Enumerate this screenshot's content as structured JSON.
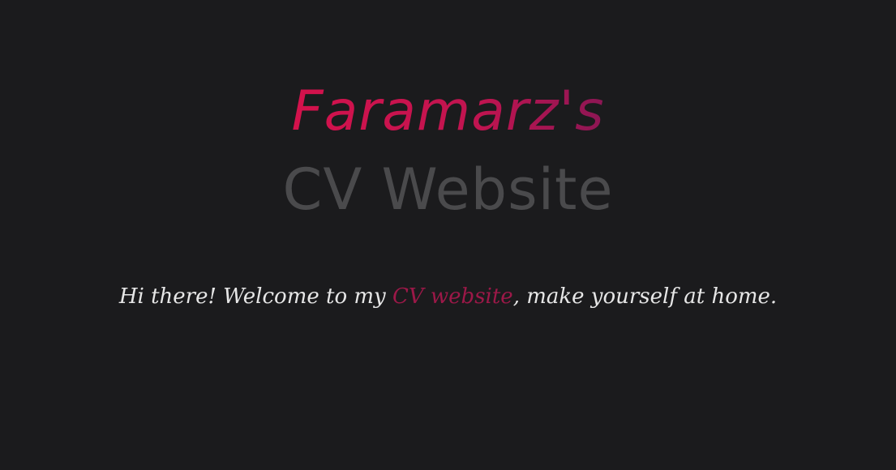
{
  "hero": {
    "title_line1": "Faramarz's",
    "title_line2": "CV Website"
  },
  "intro": {
    "before_link": "Hi there! Welcome to my ",
    "link_text": "CV website",
    "after_link": ", make yourself at home."
  },
  "colors": {
    "background": "#1b1b1d",
    "accent": "#c8124e",
    "subtitle": "#4a4a4c",
    "text": "#e6e6e6",
    "link": "#9c1848"
  }
}
